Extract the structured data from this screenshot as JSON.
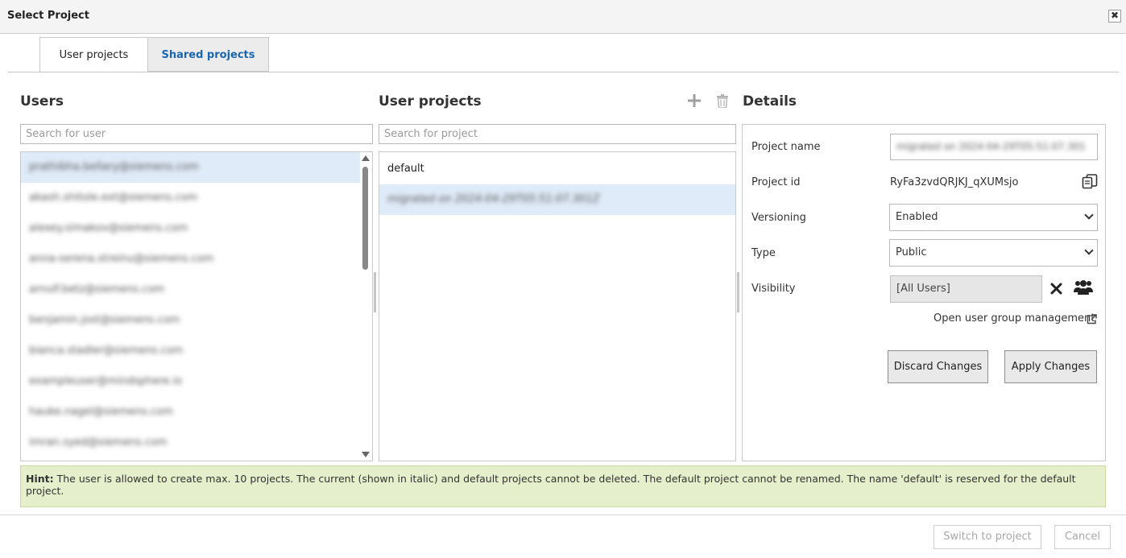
{
  "window": {
    "title": "Select Project",
    "close_glyph": "✖"
  },
  "tabs": [
    {
      "label": "User projects",
      "active": true
    },
    {
      "label": "Shared projects",
      "active": false
    }
  ],
  "users": {
    "heading": "Users",
    "search_placeholder": "Search for user",
    "items": [
      {
        "label": "prathibha.bellary@siemens.com",
        "selected": true
      },
      {
        "label": "akash.shitole.ext@siemens.com",
        "selected": false
      },
      {
        "label": "alexey.simakov@siemens.com",
        "selected": false
      },
      {
        "label": "anna-serena.streinu@siemens.com",
        "selected": false
      },
      {
        "label": "arnulf.betz@siemens.com",
        "selected": false
      },
      {
        "label": "benjamin.jost@siemens.com",
        "selected": false
      },
      {
        "label": "bianca.stadler@siemens.com",
        "selected": false
      },
      {
        "label": "exampleuser@mindsphere.io",
        "selected": false
      },
      {
        "label": "hauke.nagel@siemens.com",
        "selected": false
      },
      {
        "label": "imran.syed@siemens.com",
        "selected": false
      }
    ]
  },
  "projects": {
    "heading": "User projects",
    "search_placeholder": "Search for project",
    "add_icon": "plus-icon",
    "delete_icon": "trash-icon",
    "items": [
      {
        "label": "default",
        "selected": false
      },
      {
        "label": "migrated on 2024-04-29T05:51:07.301Z",
        "selected": true
      }
    ]
  },
  "details": {
    "heading": "Details",
    "project_name_label": "Project name",
    "project_name_value": "migrated on 2024-04-29T05:51:07.301",
    "project_id_label": "Project id",
    "project_id_value": "RyFa3zvdQRJKJ_qXUMsjo",
    "versioning_label": "Versioning",
    "versioning_value": "Enabled",
    "type_label": "Type",
    "type_value": "Public",
    "visibility_label": "Visibility",
    "visibility_value": "[All Users]",
    "group_link": "Open user group management",
    "discard_label": "Discard Changes",
    "apply_label": "Apply Changes"
  },
  "hint": {
    "prefix": "Hint:",
    "text": " The user is allowed to create max. 10 projects. The current (shown in italic) and default projects cannot be deleted. The default project cannot be renamed. The name 'default' is reserved for the default project."
  },
  "footer": {
    "switch_label": "Switch to project",
    "cancel_label": "Cancel"
  },
  "colors": {
    "accent": "#1a67b0",
    "selection": "#dfebf8",
    "hint_bg": "#e5efcb"
  }
}
